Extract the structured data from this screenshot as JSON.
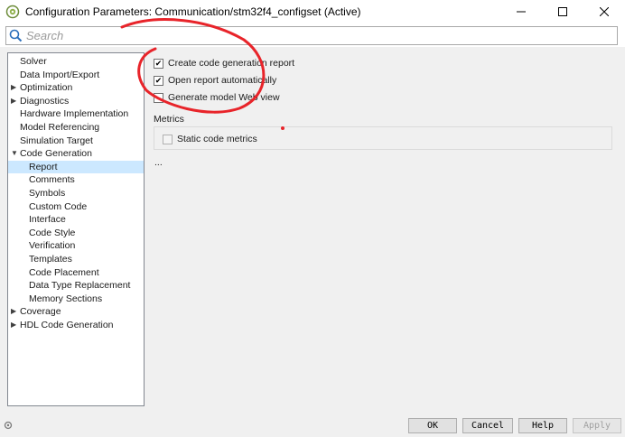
{
  "window": {
    "title": "Configuration Parameters: Communication/stm32f4_configset (Active)",
    "app_icon": "simulink-config-icon",
    "controls": {
      "minimize": "—",
      "maximize": "☐",
      "close": "✕"
    }
  },
  "search": {
    "placeholder": "Search",
    "value": ""
  },
  "tree": {
    "items": [
      {
        "label": "Solver",
        "level": 0,
        "arrow": ""
      },
      {
        "label": "Data Import/Export",
        "level": 0,
        "arrow": ""
      },
      {
        "label": "Optimization",
        "level": 0,
        "arrow": "▶"
      },
      {
        "label": "Diagnostics",
        "level": 0,
        "arrow": "▶"
      },
      {
        "label": "Hardware Implementation",
        "level": 0,
        "arrow": ""
      },
      {
        "label": "Model Referencing",
        "level": 0,
        "arrow": ""
      },
      {
        "label": "Simulation Target",
        "level": 0,
        "arrow": ""
      },
      {
        "label": "Code Generation",
        "level": 0,
        "arrow": "▼"
      },
      {
        "label": "Report",
        "level": 1,
        "arrow": "",
        "selected": true
      },
      {
        "label": "Comments",
        "level": 1,
        "arrow": ""
      },
      {
        "label": "Symbols",
        "level": 1,
        "arrow": ""
      },
      {
        "label": "Custom Code",
        "level": 1,
        "arrow": ""
      },
      {
        "label": "Interface",
        "level": 1,
        "arrow": ""
      },
      {
        "label": "Code Style",
        "level": 1,
        "arrow": ""
      },
      {
        "label": "Verification",
        "level": 1,
        "arrow": ""
      },
      {
        "label": "Templates",
        "level": 1,
        "arrow": ""
      },
      {
        "label": "Code Placement",
        "level": 1,
        "arrow": ""
      },
      {
        "label": "Data Type Replacement",
        "level": 1,
        "arrow": ""
      },
      {
        "label": "Memory Sections",
        "level": 1,
        "arrow": ""
      },
      {
        "label": "Coverage",
        "level": 0,
        "arrow": "▶"
      },
      {
        "label": "HDL Code Generation",
        "level": 0,
        "arrow": "▶"
      }
    ]
  },
  "report": {
    "options": [
      {
        "label": "Create code generation report",
        "checked": true,
        "enabled": true
      },
      {
        "label": "Open report automatically",
        "checked": true,
        "enabled": true
      },
      {
        "label": "Generate model Web view",
        "checked": false,
        "enabled": true
      }
    ],
    "metrics_label": "Metrics",
    "metrics_option": {
      "label": "Static code metrics",
      "checked": false,
      "enabled": false
    },
    "more": "..."
  },
  "buttons": {
    "ok": "OK",
    "cancel": "Cancel",
    "help": "Help",
    "apply": "Apply"
  },
  "colors": {
    "selection": "#cce8ff",
    "annotation": "#e8242a",
    "panel": "#f0f0f0"
  }
}
